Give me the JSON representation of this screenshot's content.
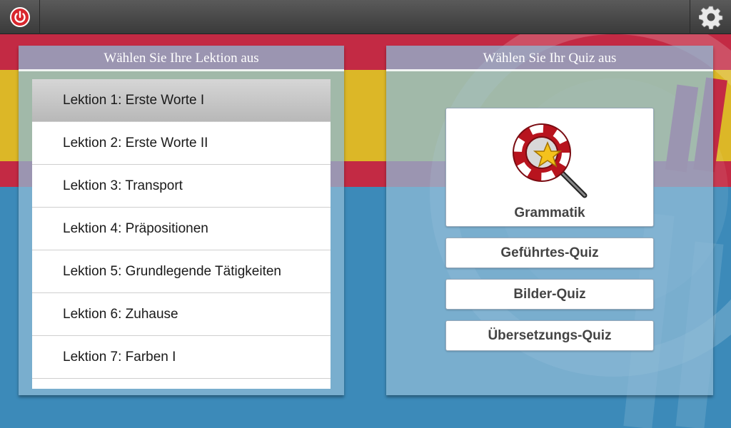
{
  "topbar": {
    "power_icon": "power-icon",
    "settings_icon": "gear-icon"
  },
  "lessons_panel": {
    "title": "Wählen Sie Ihre Lektion aus",
    "items": [
      {
        "label": "Lektion 1: Erste Worte I",
        "selected": true
      },
      {
        "label": "Lektion 2: Erste Worte II",
        "selected": false
      },
      {
        "label": "Lektion 3: Transport",
        "selected": false
      },
      {
        "label": "Lektion 4: Präpositionen",
        "selected": false
      },
      {
        "label": "Lektion 5: Grundlegende Tätigkeiten",
        "selected": false
      },
      {
        "label": "Lektion 6: Zuhause",
        "selected": false
      },
      {
        "label": "Lektion 7: Farben I",
        "selected": false
      }
    ]
  },
  "quiz_panel": {
    "title": "Wählen Sie Ihr Quiz aus",
    "grammar": {
      "label": "Grammatik",
      "icon": "lifebuoy-magnifier-star-icon"
    },
    "buttons": [
      {
        "label": "Geführtes-Quiz"
      },
      {
        "label": "Bilder-Quiz"
      },
      {
        "label": "Übersetzungs-Quiz"
      }
    ]
  },
  "colors": {
    "red": "#c32a44",
    "yellow": "#dcb727",
    "blue": "#3c8ab9"
  }
}
